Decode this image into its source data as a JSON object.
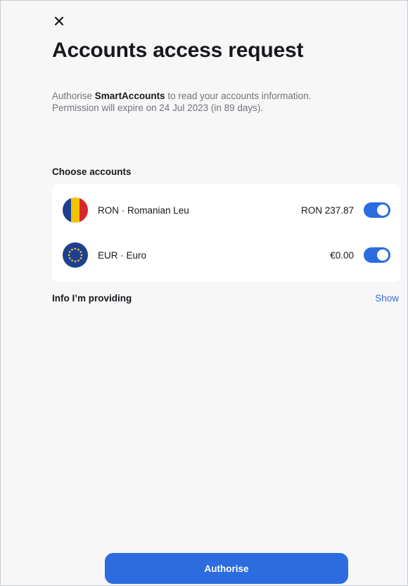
{
  "header": {
    "close_icon": "close-icon",
    "title": "Accounts access request"
  },
  "consent": {
    "prefix": "Authorise ",
    "app_name": "SmartAccounts",
    "suffix": " to read your accounts information.",
    "expiry_line": "Permission will expire on 24 Jul 2023 (in 89 days)."
  },
  "accounts": {
    "section_label": "Choose accounts",
    "items": [
      {
        "flag_icon": "romania-flag-icon",
        "name": "RON · Romanian Leu",
        "balance": "RON 237.87",
        "selected": true
      },
      {
        "flag_icon": "eu-flag-icon",
        "name": "EUR · Euro",
        "balance": "€0.00",
        "selected": true
      }
    ]
  },
  "info": {
    "label": "Info I’m providing",
    "show_link": "Show"
  },
  "footer": {
    "authorise_label": "Authorise"
  },
  "colors": {
    "accent": "#2c6cdf",
    "link": "#3b6fd8",
    "background": "#f7f7f8",
    "card": "#ffffff",
    "muted_text": "#6f737a"
  }
}
